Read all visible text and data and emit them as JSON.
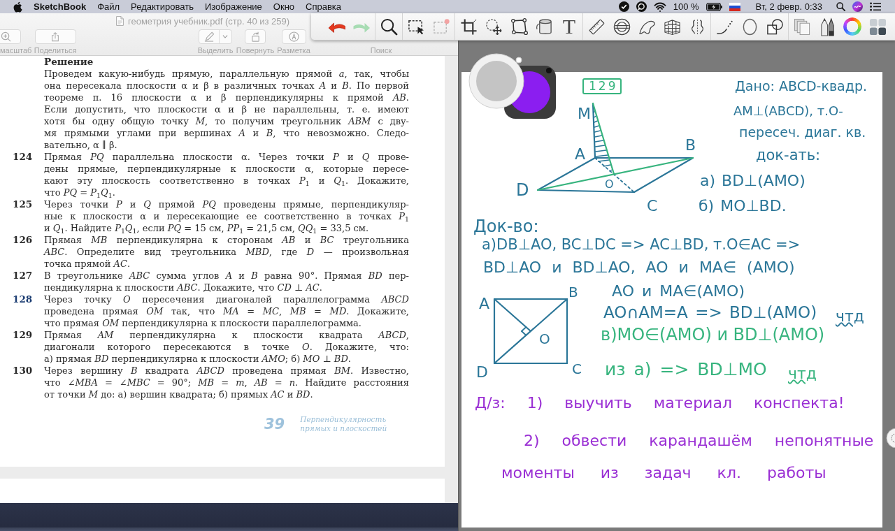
{
  "menu_bar": {
    "app_name": "SketchBook",
    "menus": [
      "Файл",
      "Редактировать",
      "Изображение",
      "Окно",
      "Справка"
    ],
    "battery_text": "100 %",
    "clock": "Вт, 2 февр. 0:33"
  },
  "preview_window": {
    "title": "геометрия учебник.pdf (стр. 40 из 259)",
    "toolbar": [
      {
        "kind": "zoom",
        "label": "масштаб"
      },
      {
        "kind": "share",
        "label": "Поделиться"
      },
      {
        "kind": "highlight",
        "label": "Выделить"
      },
      {
        "kind": "rotate",
        "label": "Повернуть"
      },
      {
        "kind": "markup",
        "label": "Разметка"
      },
      {
        "kind": "search",
        "label": "Поиск"
      }
    ],
    "page": {
      "heading": "Решение",
      "solution_lines": [
        "Проведем какую-нибудь прямую, параллельную прямой *a*, так, чтобы",
        "она пересекала плоскости α и β в различных точках *A* и *B*. По первой",
        "теореме п. 16 плоскости α и β перпендикулярны к прямой *AB*.",
        "Если допустить, что плоскости α и β не параллельны, т. е. имеют",
        "хотя бы одну общую точку *M*, то получим треугольник *ABM* с дву-",
        "мя прямыми углами при вершинах *A* и *B*, что невозможно. Следо-",
        "вательно, α ∥ β."
      ],
      "problems": [
        {
          "number": "124",
          "highlighted": false,
          "lines": [
            "Прямая *PQ* параллельна плоскости α. Через точки *P* и *Q* прове-",
            "дены прямые, перпендикулярные к плоскости α, которые пересе-",
            "кают эту плоскость соответственно в точках *P*$_{1}$ и *Q*$_{1}$. Докажите,",
            "что *PQ* = *P*$_{1}$*Q*$_{1}$."
          ]
        },
        {
          "number": "125",
          "highlighted": false,
          "lines": [
            "Через точки *P* и *Q* прямой *PQ* проведены прямые, перпендикуляр-",
            "ные к плоскости α и пересекающие ее соответственно в точках *P*$_{1}$",
            "и *Q*$_{1}$. Найдите *P*$_{1}$*Q*$_{1}$, если *PQ* = 15 см, *PP*$_{1}$ = 21,5 см, *QQ*$_{1}$ = 33,5 см."
          ]
        },
        {
          "number": "126",
          "highlighted": false,
          "lines": [
            "Прямая *MB* перпендикулярна к сторонам *AB* и *BC* треугольника",
            "*ABC*. Определите вид треугольника *MBD*, где *D* — произвольная",
            "точка прямой *AC*."
          ]
        },
        {
          "number": "127",
          "highlighted": false,
          "lines": [
            "В треугольнике *ABC* сумма углов *A* и *B* равна 90°. Прямая *BD* пер-",
            "пендикулярна к плоскости *ABC*. Докажите, что *CD* ⊥ *AC*."
          ]
        },
        {
          "number": "128",
          "highlighted": true,
          "lines": [
            "Через точку *O* пересечения диагоналей параллелограмма *ABCD*",
            "проведена прямая *OM* так, что *MA* = *MC*, *MB* = *MD*. Докажите,",
            "что прямая *OM* перпендикулярна к плоскости параллелограмма."
          ]
        },
        {
          "number": "129",
          "highlighted": false,
          "lines": [
            "Прямая *AM* перпендикулярна к плоскости квадрата *ABCD*,",
            "диагонали которого пересекаются в точке *O*. Докажите, что:",
            "а) прямая *BD* перпендикулярна к плоскости *AMO*; б) *MO* ⊥ *BD*."
          ]
        },
        {
          "number": "130",
          "highlighted": false,
          "lines": [
            "Через вершину *B* квадрата *ABCD* проведена прямая *BM*. Известно,",
            "что ∠*MBA* = ∠*MBC* = 90°; *MB* = *m*, *AB* = *n*. Найдите расстояния",
            "от точки *M* до: а) вершин квадрата; б) прямых *AC* и *BD*."
          ]
        }
      ],
      "page_number": "39",
      "running_title": [
        "Перпендикулярность",
        "прямых и плоскостей"
      ]
    }
  },
  "sketchbook": {
    "toolbar": {
      "text_tool": "T"
    },
    "canvas": {
      "problem_tag": "129",
      "figures": [
        {
          "kind": "pyramid",
          "points": [
            "M",
            "A",
            "B",
            "D",
            "C",
            "O"
          ]
        },
        {
          "kind": "square",
          "points": [
            "A",
            "B",
            "D",
            "C",
            "O"
          ]
        }
      ],
      "notes": [
        {
          "text": "Дано: ABCD-квадр.",
          "color": "#2b7698",
          "underlined": false
        },
        {
          "text": "AM⊥(ABCD), т.О-",
          "color": "#2b7698",
          "underlined": false
        },
        {
          "text": "пересеч. диаг. кв.",
          "color": "#2b7698",
          "underlined": false
        },
        {
          "text": "док-ать:",
          "color": "#2b7698",
          "underlined": false
        },
        {
          "text": "а) BD⊥(AMO)",
          "color": "#2b7698",
          "underlined": false
        },
        {
          "text": "б) MO⊥BD.",
          "color": "#2b7698",
          "underlined": false
        },
        {
          "text": "Док-во:",
          "color": "#2b7698",
          "underlined": false
        },
        {
          "text": "а)DB⊥AO, BC⊥DC => AC⊥BD, т.O∈AC =>",
          "color": "#2b7698",
          "underlined": false
        },
        {
          "text": "BD⊥AO и BD⊥AO, AO и MA∈ (AMO)",
          "color": "#2b7698",
          "underlined": false
        },
        {
          "text": "AO и MA∈(AMO)",
          "color": "#2b7698",
          "underlined": false
        },
        {
          "text": "AO∩AM=A => BD⊥(AMO)",
          "color": "#2b7698",
          "underlined": false
        },
        {
          "text": "чтд",
          "color": "#2b7698",
          "underlined": true
        },
        {
          "text": "в)MO∈(AMO) и BD⊥(AMO)",
          "color": "#37b47e",
          "underlined": false
        },
        {
          "text": "из а) => BD⊥MO",
          "color": "#37b47e",
          "underlined": false
        },
        {
          "text": "чтд",
          "color": "#37b47e",
          "underlined": true
        },
        {
          "text": "Д/з: 1) выучить материал конспекта!",
          "color": "#9a2fd4",
          "underlined": false
        },
        {
          "text": "2) обвести карандашём непонятные",
          "color": "#9a2fd4",
          "underlined": false
        },
        {
          "text": "моменты из задач кл. работы",
          "color": "#9a2fd4",
          "underlined": false
        }
      ]
    }
  }
}
